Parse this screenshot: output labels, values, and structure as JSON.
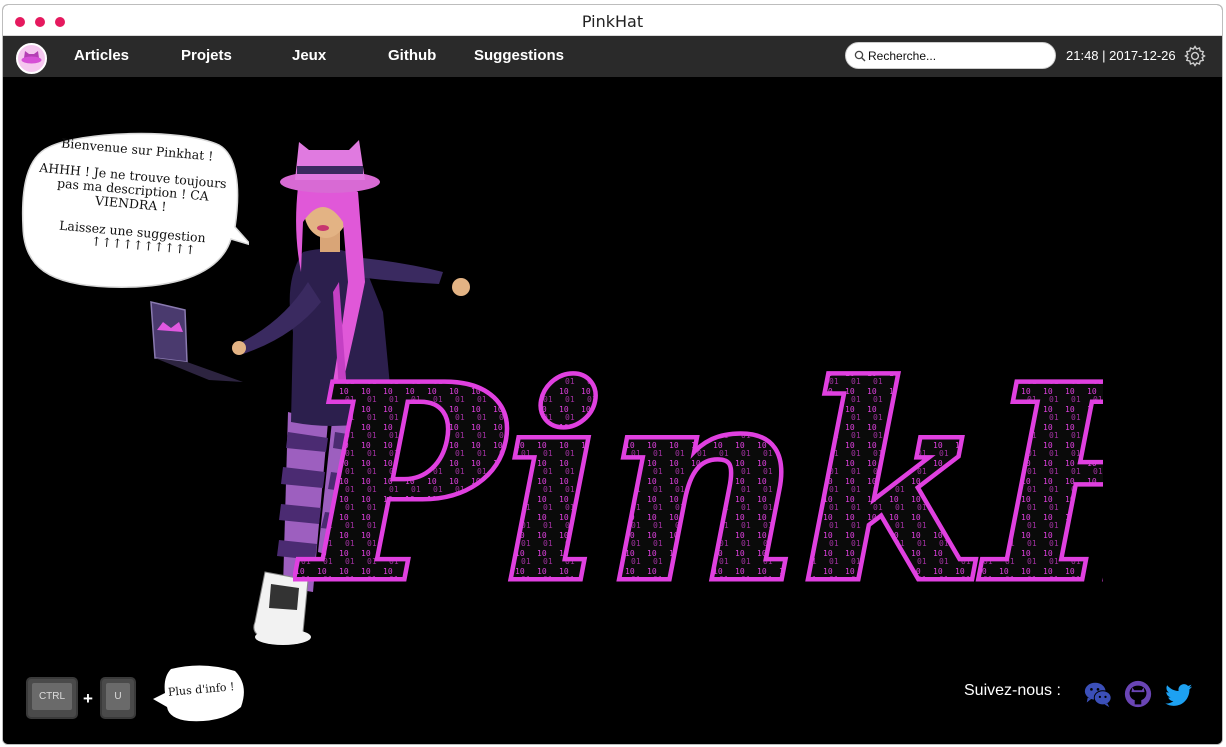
{
  "window": {
    "title": "PinkHat"
  },
  "nav": {
    "items": [
      {
        "label": "Articles"
      },
      {
        "label": "Projets"
      },
      {
        "label": "Jeux"
      },
      {
        "label": "Github"
      },
      {
        "label": "Suggestions"
      }
    ],
    "search_placeholder": "Recherche...",
    "clock": "21:48 | 2017-12-26"
  },
  "hero": {
    "bubble_lines": [
      "Bienvenue sur Pinkhat !",
      "AHHH ! Je ne trouve toujours",
      "pas ma description ! CA",
      "VIENDRA !",
      "Laissez une suggestion",
      "↑↑↑↑↑↑↑↑↑↑"
    ],
    "logo_text": "PinkHat"
  },
  "footer": {
    "key_ctrl": "CTRL",
    "plus": "+",
    "key_u": "U",
    "more_info": "Plus d'info !",
    "follow_label": "Suivez-nous :"
  },
  "colors": {
    "accent": "#e5195e",
    "brand_pink": "#e040e0",
    "navbar": "#2a2a2a",
    "twitter": "#1da1f2",
    "wechat": "#3b4fb8",
    "github": "#6a45b5"
  },
  "icons": {
    "logo": "pinkhat-logo-icon",
    "search": "search-icon",
    "settings": "gear-icon",
    "social": [
      "wechat-icon",
      "github-icon",
      "twitter-icon"
    ]
  }
}
